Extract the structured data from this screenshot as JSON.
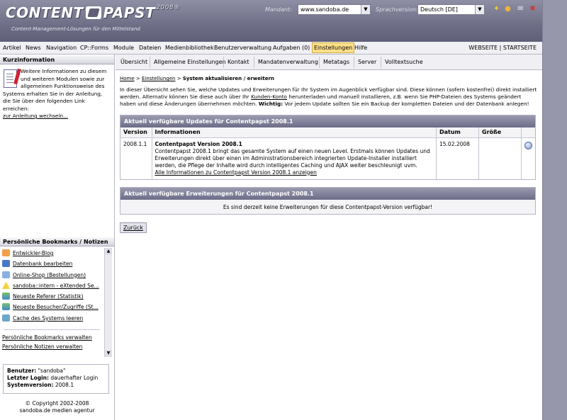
{
  "header": {
    "logo_text": "CONTENT",
    "logo_text2": "PAPST",
    "logo_version": "2008®",
    "tagline": "Content-Management-Lösungen für den Mittelstand",
    "mandant_label": "Mandant:",
    "mandant_value": "www.sandoba.de",
    "sprach_label": "Sprachversion:",
    "sprach_value": "Deutsch [DE]",
    "icons": [
      "wand-icon",
      "help-icon",
      "mail-icon",
      "close-icon"
    ]
  },
  "menu": {
    "items": [
      "Artikel",
      "News",
      "Navigation",
      "CP::Forms",
      "Module",
      "Dateien",
      "Medienbibliothek",
      "Benutzerverwaltung",
      "Aufgaben (0)",
      "Einstellungen",
      "Hilfe"
    ],
    "active": "Einstellungen",
    "right": "WEBSEITE | STARTSEITE"
  },
  "kurz": {
    "title": "Kurzinformation",
    "text": "Weitere Informationen zu diesem und weiteren Modulen sowie zur allgemeinen Funktionsweise des Systems erhalten Sie in der Anleitung, die Sie über den folgenden Link erreichen:",
    "link": "zur Anleitung wechseln..."
  },
  "bookmarks": {
    "title": "Persönliche Bookmarks / Notizen",
    "items": [
      {
        "label": "Entwickler-Blog",
        "icon": "blog-icon"
      },
      {
        "label": "Datenbank bearbeiten",
        "icon": "database-icon"
      },
      {
        "label": "Online-Shop (Bestellungen)",
        "icon": "shop-icon"
      },
      {
        "label": "sandoba::intern - eXtended Se...",
        "icon": "warning-icon"
      },
      {
        "label": "Neueste Referer (Statistik)",
        "icon": "chart-icon"
      },
      {
        "label": "Neueste Besucher/Zugriffe (St...",
        "icon": "chart-icon"
      },
      {
        "label": "Cache des Systems leeren",
        "icon": "cache-icon"
      }
    ],
    "manage_bookmarks": "Persönliche Bookmarks verwalten",
    "manage_notes": "Persönliche Notizen verwalten"
  },
  "user": {
    "user_label": "Benutzer:",
    "user_value": "\"sandoba\"",
    "login_label": "Letzter Login:",
    "login_value": "dauerhafter Login",
    "version_label": "Systemversion:",
    "version_value": "2008.1"
  },
  "copyright": {
    "line1": "© Copyright 2002-2008",
    "line2": "sandoba.de medien agentur"
  },
  "tabs": [
    "Übersicht",
    "Allgemeine Einstellungen",
    "Kontakt",
    "Mandatenverwaltung",
    "Metatags",
    "Server",
    "Volltextsuche"
  ],
  "breadcrumb": {
    "home": "Home",
    "sep": ">",
    "settings": "Einstellungen",
    "current": "System aktualisieren / erweitern"
  },
  "intro": {
    "part1": "In dieser Übersicht sehen Sie, welche Updates und Erweiterungen für Ihr System im Augenblick verfügbar sind. Diese können (sofern kostenfrei) direkt installiert werden. Alternativ können Sie diese auch über Ihr",
    "link": "Kunden-Konto",
    "part2": "herunterladen und manuell installieren, z.B. wenn Sie PHP-Dateien des Systems geändert haben und diese Änderungen übernehmen möchten.",
    "warn_label": "Wichtig:",
    "warn_text": "Vor jedem Update sollten Sie ein Backup der kompletten Dateien und der Datenbank anlegen!"
  },
  "updates": {
    "title": "Aktuell verfügbare Updates für Contentpapst 2008.1",
    "columns": [
      "Version",
      "Informationen",
      "Datum",
      "Größe"
    ],
    "rows": [
      {
        "version": "2008.1.1",
        "info_title": "Contentpapst Version 2008.1",
        "info_text": "Contentpapst 2008.1 bringt das gesamte System auf einen neuen Level. Erstmals können Updates und Erweiterungen direkt über einen im Administrationsbereich integrierten Update-Installer installiert werden, die Pflege der Inhalte wird durch intelligentes Caching und AJAX weiter beschleunigt uvm.",
        "info_link": "Alle Informationen zu Contentpapst Version 2008.1 anzeigen",
        "date": "15.02.2008",
        "size": ""
      }
    ]
  },
  "extensions": {
    "title": "Aktuell verfügbare Erweiterungen für Contentpapst 2008.1",
    "empty": "Es sind derzeit keine Erweiterungen für diese Contentpapst-Version verfügbar!"
  },
  "back_label": "Zurück"
}
